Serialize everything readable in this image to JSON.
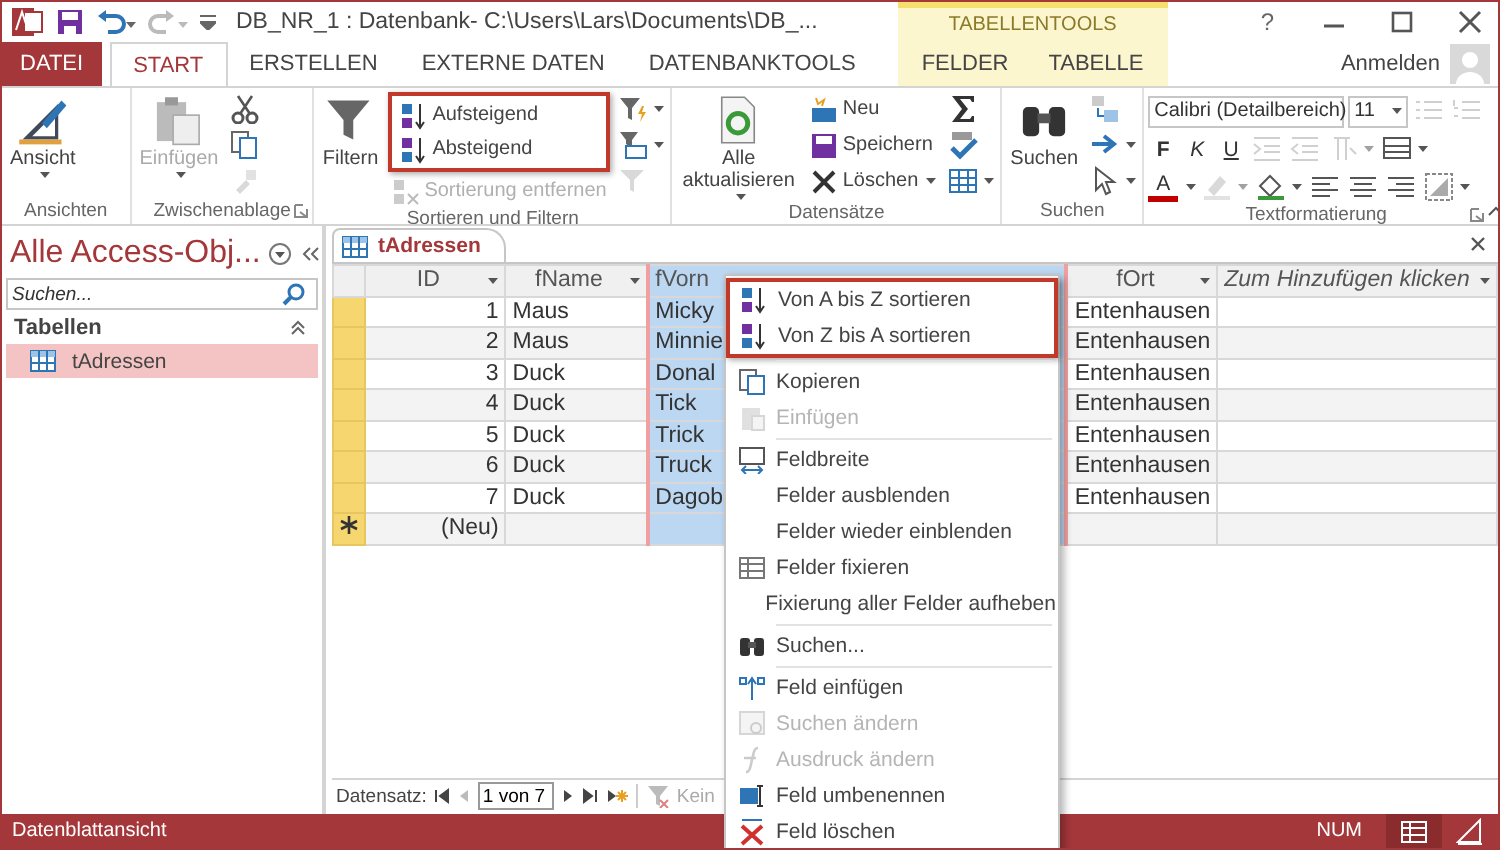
{
  "window": {
    "title": "DB_NR_1 : Datenbank- C:\\Users\\Lars\\Documents\\DB_...",
    "help": "?",
    "context_label": "TABELLENTOOLS",
    "account": "Anmelden"
  },
  "tabs": [
    {
      "label": "DATEI",
      "kind": "file",
      "selected": false
    },
    {
      "label": "START",
      "kind": "normal",
      "selected": true
    },
    {
      "label": "ERSTELLEN",
      "kind": "normal",
      "selected": false
    },
    {
      "label": "EXTERNE DATEN",
      "kind": "normal",
      "selected": false
    },
    {
      "label": "DATENBANKTOOLS",
      "kind": "normal",
      "selected": false
    },
    {
      "label": "FELDER",
      "kind": "contextual",
      "selected": false
    },
    {
      "label": "TABELLE",
      "kind": "contextual",
      "selected": false
    }
  ],
  "ribbon": {
    "groups": [
      {
        "label": "Ansichten",
        "launcher": false,
        "items": [
          {
            "kind": "large",
            "label": "Ansicht",
            "dropdown": true,
            "disabled": false
          }
        ]
      },
      {
        "label": "Zwischenablage",
        "launcher": true,
        "items": [
          {
            "kind": "large",
            "label": "Einfügen",
            "dropdown": true,
            "disabled": true
          },
          {
            "kind": "icon",
            "dropdown": false,
            "disabled": false
          },
          {
            "kind": "icon",
            "dropdown": false,
            "disabled": false
          },
          {
            "kind": "icon",
            "dropdown": false,
            "disabled": true
          }
        ]
      },
      {
        "label": "Sortieren und Filtern",
        "launcher": false,
        "items": [
          {
            "kind": "large",
            "label": "Filtern",
            "dropdown": false,
            "disabled": false
          },
          {
            "kind": "small",
            "label": "Aufsteigend",
            "dropdown": false,
            "disabled": false,
            "highlighted": true
          },
          {
            "kind": "small",
            "label": "Absteigend",
            "dropdown": false,
            "disabled": false,
            "highlighted": true
          },
          {
            "kind": "small",
            "label": "Sortierung entfernen",
            "dropdown": false,
            "disabled": true,
            "highlighted": false
          },
          {
            "kind": "icon",
            "dropdown": true,
            "disabled": false
          },
          {
            "kind": "icon",
            "dropdown": true,
            "disabled": false
          },
          {
            "kind": "icon",
            "dropdown": false,
            "disabled": true
          }
        ]
      },
      {
        "label": "Datensätze",
        "launcher": false,
        "items": [
          {
            "kind": "large",
            "label": "Alle aktualisieren",
            "dropdown": true,
            "disabled": false
          },
          {
            "kind": "small",
            "label": "Neu",
            "dropdown": false,
            "disabled": false
          },
          {
            "kind": "small",
            "label": "Speichern",
            "dropdown": false,
            "disabled": false
          },
          {
            "kind": "small",
            "label": "Löschen",
            "dropdown": true,
            "disabled": false
          },
          {
            "kind": "icon",
            "dropdown": false,
            "disabled": false
          },
          {
            "kind": "icon",
            "dropdown": false,
            "disabled": false
          },
          {
            "kind": "icon",
            "dropdown": true,
            "disabled": false
          }
        ]
      },
      {
        "label": "Suchen",
        "launcher": false,
        "items": [
          {
            "kind": "large",
            "label": "Suchen",
            "dropdown": false,
            "disabled": false
          },
          {
            "kind": "icon",
            "dropdown": false,
            "disabled": false
          },
          {
            "kind": "icon",
            "dropdown": true,
            "disabled": false
          },
          {
            "kind": "icon",
            "dropdown": true,
            "disabled": false
          }
        ]
      },
      {
        "label": "Textformatierung",
        "launcher": true,
        "rows": [
          [
            {
              "kind": "font_field",
              "value": "Calibri (Detailbereich)"
            },
            {
              "kind": "size_field",
              "value": "11"
            },
            {
              "kind": "icon",
              "dropdown": false,
              "disabled": true
            },
            {
              "kind": "icon",
              "dropdown": false,
              "disabled": true
            }
          ],
          [
            {
              "kind": "bold_button",
              "label": "F"
            },
            {
              "kind": "italic_button",
              "label": "K"
            },
            {
              "kind": "underline_button",
              "label": "U"
            },
            {
              "kind": "icon",
              "dropdown": false,
              "disabled": true
            },
            {
              "kind": "icon",
              "dropdown": false,
              "disabled": true
            },
            {
              "kind": "icon",
              "dropdown": true,
              "disabled": true
            },
            {
              "kind": "icon",
              "dropdown": true,
              "disabled": false
            }
          ],
          [
            {
              "kind": "color_button",
              "label": "A"
            },
            {
              "kind": "icon",
              "dropdown": true,
              "disabled": true
            },
            {
              "kind": "icon",
              "dropdown": true,
              "disabled": false
            },
            {
              "kind": "icon",
              "dropdown": false,
              "disabled": false
            },
            {
              "kind": "icon",
              "dropdown": false,
              "disabled": false
            },
            {
              "kind": "icon",
              "dropdown": false,
              "disabled": false
            },
            {
              "kind": "icon",
              "dropdown": true,
              "disabled": false
            }
          ]
        ]
      }
    ]
  },
  "navigation": {
    "title": "Alle Access-Obj...",
    "search_placeholder": "Suchen...",
    "sections": [
      {
        "label": "Tabellen",
        "expanded": true,
        "items": [
          {
            "label": "tAdressen",
            "selected": true
          }
        ]
      }
    ]
  },
  "datasheet": {
    "tab": "tAdressen",
    "columns": [
      {
        "label": "ID",
        "kind": "number",
        "selected": false
      },
      {
        "label": "fName",
        "kind": "text",
        "selected": false
      },
      {
        "label": "fVorn",
        "kind": "text",
        "selected": true
      },
      {
        "label": "fOrt",
        "kind": "text",
        "selected": false
      },
      {
        "label": "Zum Hinzufügen klicken",
        "kind": "add",
        "selected": false
      }
    ],
    "rows": [
      {
        "cells": [
          "1",
          "Maus",
          "Micky",
          "Entenhausen"
        ]
      },
      {
        "cells": [
          "2",
          "Maus",
          "Minnie",
          "Entenhausen"
        ]
      },
      {
        "cells": [
          "3",
          "Duck",
          "Donal",
          "Entenhausen"
        ]
      },
      {
        "cells": [
          "4",
          "Duck",
          "Tick",
          "Entenhausen"
        ]
      },
      {
        "cells": [
          "5",
          "Duck",
          "Trick",
          "Entenhausen"
        ]
      },
      {
        "cells": [
          "6",
          "Duck",
          "Truck",
          "Entenhausen"
        ]
      },
      {
        "cells": [
          "7",
          "Duck",
          "Dagob",
          "Entenhausen"
        ]
      }
    ],
    "new_row": {
      "cells": [
        "(Neu)"
      ]
    },
    "record_nav": {
      "label": "Datensatz:",
      "position": "1 von 7",
      "filter": "Kein"
    }
  },
  "context_menu": {
    "sections": [
      {
        "items": [
          {
            "label": "Von A bis Z sortieren",
            "disabled": false,
            "highlighted": true
          },
          {
            "label": "Von Z bis A sortieren",
            "disabled": false,
            "highlighted": true
          }
        ]
      },
      {
        "items": [
          {
            "label": "Kopieren",
            "disabled": false,
            "highlighted": false
          },
          {
            "label": "Einfügen",
            "disabled": true,
            "highlighted": false
          }
        ]
      },
      {
        "items": [
          {
            "label": "Feldbreite",
            "disabled": false,
            "highlighted": false
          },
          {
            "label": "Felder ausblenden",
            "disabled": false,
            "highlighted": false
          },
          {
            "label": "Felder wieder einblenden",
            "disabled": false,
            "highlighted": false
          },
          {
            "label": "Felder fixieren",
            "disabled": false,
            "highlighted": false
          },
          {
            "label": "Fixierung aller Felder aufheben",
            "disabled": false,
            "highlighted": false
          }
        ]
      },
      {
        "items": [
          {
            "label": "Suchen...",
            "disabled": false,
            "highlighted": false
          }
        ]
      },
      {
        "items": [
          {
            "label": "Feld einfügen",
            "disabled": false,
            "highlighted": false
          },
          {
            "label": "Suchen ändern",
            "disabled": true,
            "highlighted": false
          },
          {
            "label": "Ausdruck ändern",
            "disabled": true,
            "highlighted": false
          },
          {
            "label": "Feld umbenennen",
            "disabled": false,
            "highlighted": false
          },
          {
            "label": "Feld löschen",
            "disabled": false,
            "highlighted": false
          }
        ]
      }
    ]
  },
  "status_bar": {
    "text": "Datenblattansicht",
    "indicator": "NUM",
    "views": [
      {
        "selected": true
      },
      {
        "selected": false
      }
    ]
  }
}
